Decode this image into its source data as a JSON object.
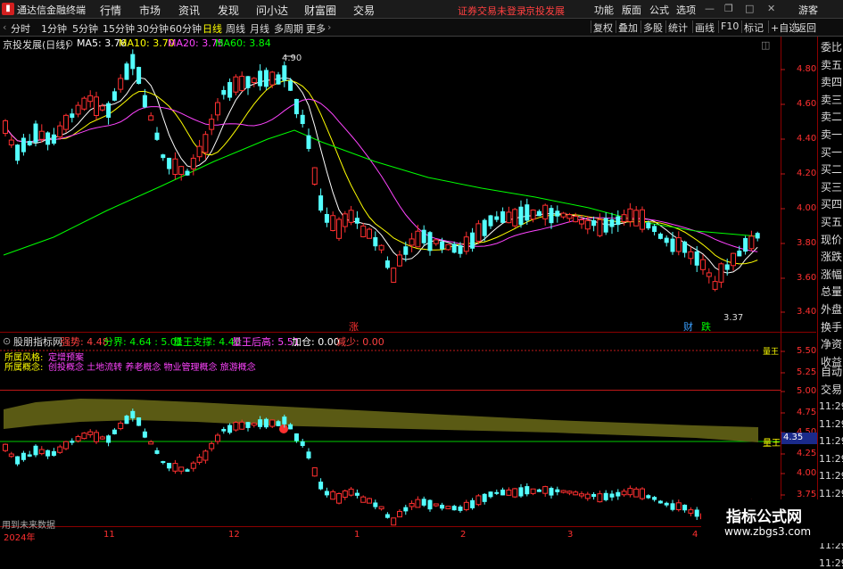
{
  "titlebar": {
    "app_title": "通达信金融终端",
    "menus": [
      "行情",
      "市场",
      "资讯",
      "发现",
      "问小达",
      "财富圈",
      "交易"
    ],
    "login_warning": "证券交易未登录",
    "stock_name": "京投发展",
    "right_menus": [
      "功能",
      "版面",
      "公式",
      "选项"
    ],
    "guest": "游客"
  },
  "toolbar": {
    "periods": [
      "分时",
      "1分钟",
      "5分钟",
      "15分钟",
      "30分钟",
      "60分钟",
      "日线",
      "周线",
      "月线",
      "多周期",
      "更多"
    ],
    "active_period": "日线",
    "buttons": [
      "复权",
      "叠加",
      "多股",
      "统计",
      "画线",
      "F10",
      "标记",
      "+自选",
      "返回"
    ]
  },
  "main_chart": {
    "name": "京投发展(日线)",
    "ma": [
      {
        "label": "MA5: 3.76",
        "color": "#ffffff"
      },
      {
        "label": "MA10: 3.70",
        "color": "#ffff00"
      },
      {
        "label": "MA20: 3.75",
        "color": "#ff44ff"
      },
      {
        "label": "MA60: 3.84",
        "color": "#00ff00"
      }
    ],
    "high_label": "4.90",
    "low_label": "3.37",
    "y_ticks": [
      "4.80",
      "4.60",
      "4.40",
      "4.20",
      "4.00",
      "3.80",
      "3.60",
      "3.40"
    ],
    "marker_zhang": "涨",
    "marker_cai": "财",
    "marker_die": "跌"
  },
  "indicator": {
    "name": "股朋指标网",
    "values": [
      {
        "label": "强势: 4.48",
        "color": "#ff4040"
      },
      {
        "label": "分界: 4.64 : 5.01",
        "color": "#00ff00"
      },
      {
        "label": "量王支撑: 4.40",
        "color": "#00ff00"
      },
      {
        "label": "量王后高: 5.51",
        "color": "#ff44ff"
      },
      {
        "label": "加仓: 0.00",
        "color": "#ffffff"
      },
      {
        "label": "减少: 0.00",
        "color": "#ff4040"
      }
    ],
    "style_label": "所属风格:",
    "style_value": "定增预案",
    "concept_label": "所属概念:",
    "concept_value": "创投概念 土地流转 养老概念 物业管理概念 旅游概念",
    "y_ticks": [
      "5.50",
      "5.25",
      "5.00",
      "4.75",
      "4.50",
      "4.25",
      "4.00",
      "3.75"
    ],
    "level_tag": "量王",
    "current_value": "4.35",
    "ref_line": "量王"
  },
  "footer": {
    "data_source": "用到未来数据",
    "year": "2024年",
    "months": [
      "11",
      "12",
      "1",
      "2",
      "3",
      "4"
    ]
  },
  "side_panel": {
    "items": [
      "委比",
      "卖五",
      "卖四",
      "卖三",
      "卖二",
      "卖一",
      "买一",
      "买二",
      "买三",
      "买四",
      "买五",
      "现价",
      "涨跌",
      "涨幅",
      "总量",
      "外盘",
      "换手",
      "净资",
      "收益",
      "自动",
      "交易"
    ],
    "times": [
      "11:29",
      "11:29",
      "11:29",
      "11:29",
      "11:29",
      "11:29",
      "11:29",
      "11:29",
      "11:29",
      "11:29"
    ]
  },
  "watermark": {
    "title": "指标公式网",
    "url": "www.zbgs3.com"
  }
}
